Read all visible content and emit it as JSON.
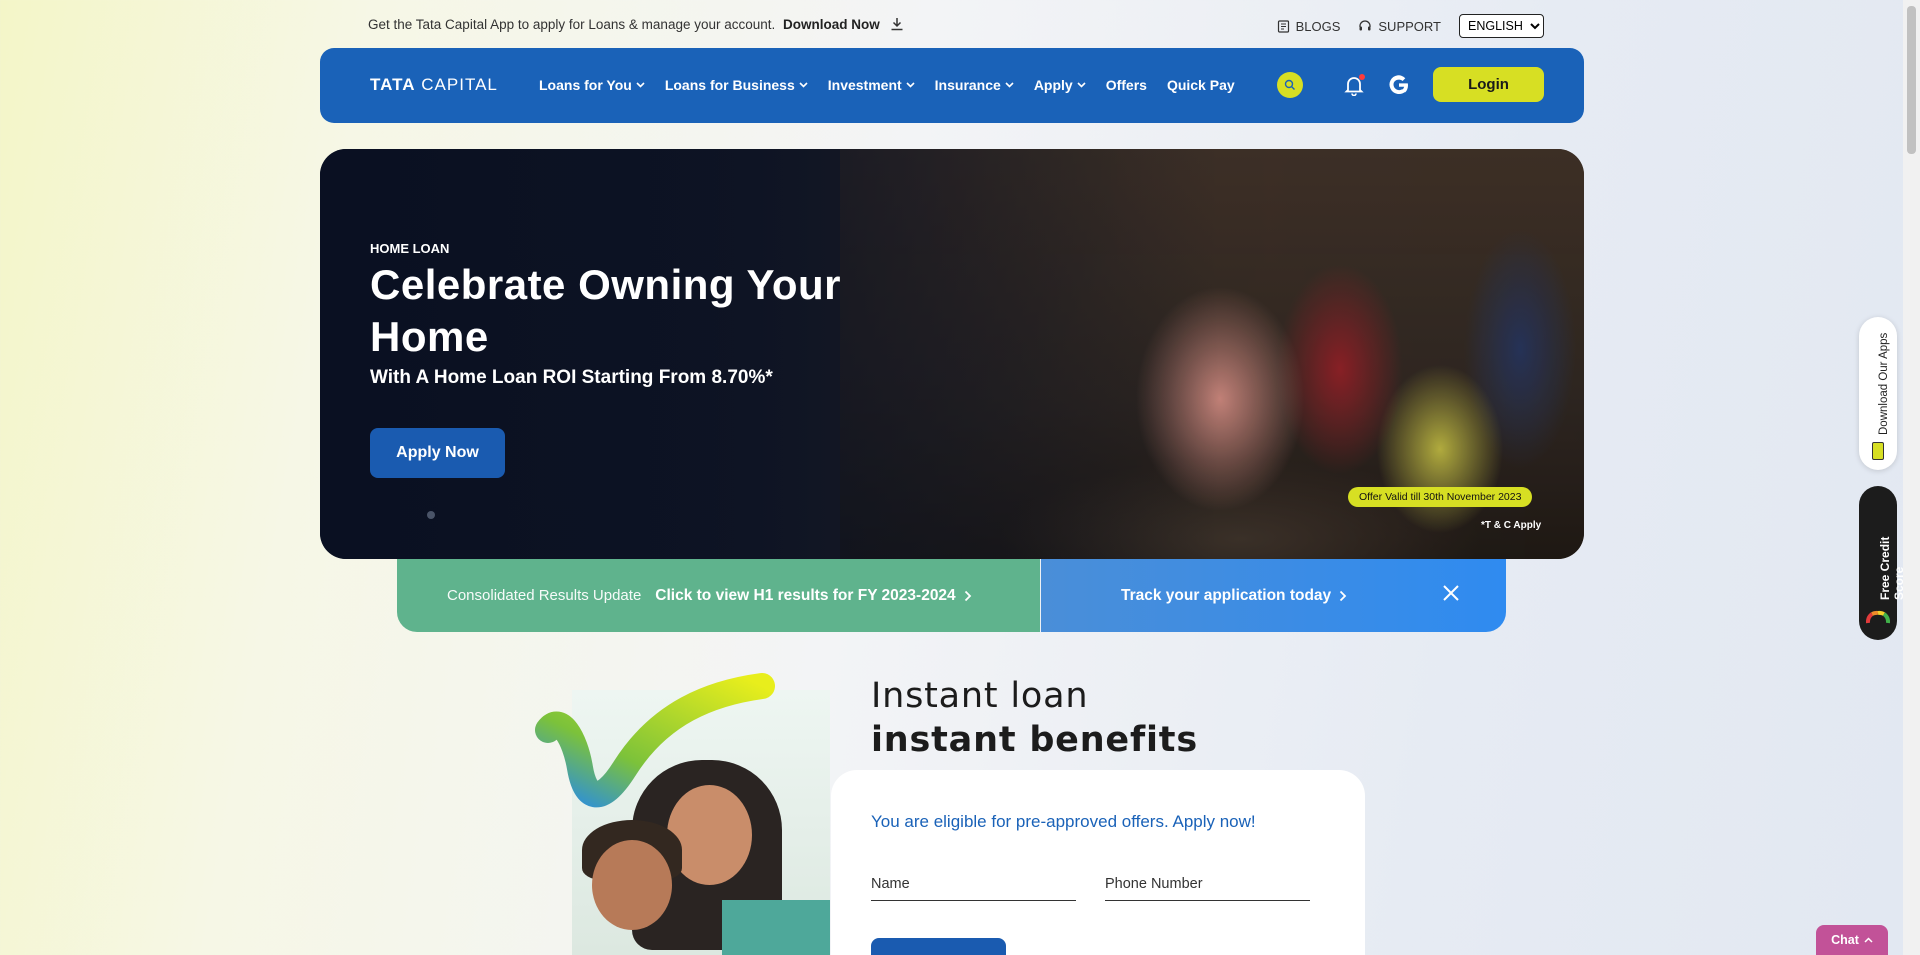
{
  "topbar": {
    "promo_text": "Get the Tata Capital App to apply for Loans & manage your account.",
    "download_label": "Download Now",
    "blogs_label": "BLOGS",
    "support_label": "SUPPORT",
    "language_selected": "ENGLISH"
  },
  "navbar": {
    "logo_bold": "TATA",
    "logo_rest": " CAPITAL",
    "items": [
      {
        "label": "Loans for You",
        "dropdown": true
      },
      {
        "label": "Loans for Business",
        "dropdown": true
      },
      {
        "label": "Investment",
        "dropdown": true
      },
      {
        "label": "Insurance",
        "dropdown": true
      },
      {
        "label": "Apply",
        "dropdown": true
      },
      {
        "label": "Offers",
        "dropdown": false
      },
      {
        "label": "Quick Pay",
        "dropdown": false
      }
    ],
    "login_label": "Login",
    "accent_color": "#d7df23",
    "brand_color": "#1a62b8"
  },
  "hero": {
    "tag": "HOME LOAN",
    "title": "Celebrate Owning Your Home",
    "subtitle": "With A Home Loan ROI Starting From 8.70%*",
    "apply_label": "Apply Now",
    "offer_text": "Offer Valid till 30th November 2023",
    "tc_text": "*T & C Apply"
  },
  "strip": {
    "left_muted": "Consolidated Results Update",
    "left_link": "Click to view H1 results for FY 2023-2024",
    "right_link": "Track your application today"
  },
  "instant": {
    "line1": "Instant loan",
    "line2": "instant benefits",
    "eligible_text": "You are eligible for pre-approved offers. Apply now!",
    "name_label": "Name",
    "phone_label": "Phone Number"
  },
  "side": {
    "apps_label": "Download Our Apps",
    "score_label": "Free Credit Score"
  },
  "chat": {
    "label": "Chat"
  }
}
